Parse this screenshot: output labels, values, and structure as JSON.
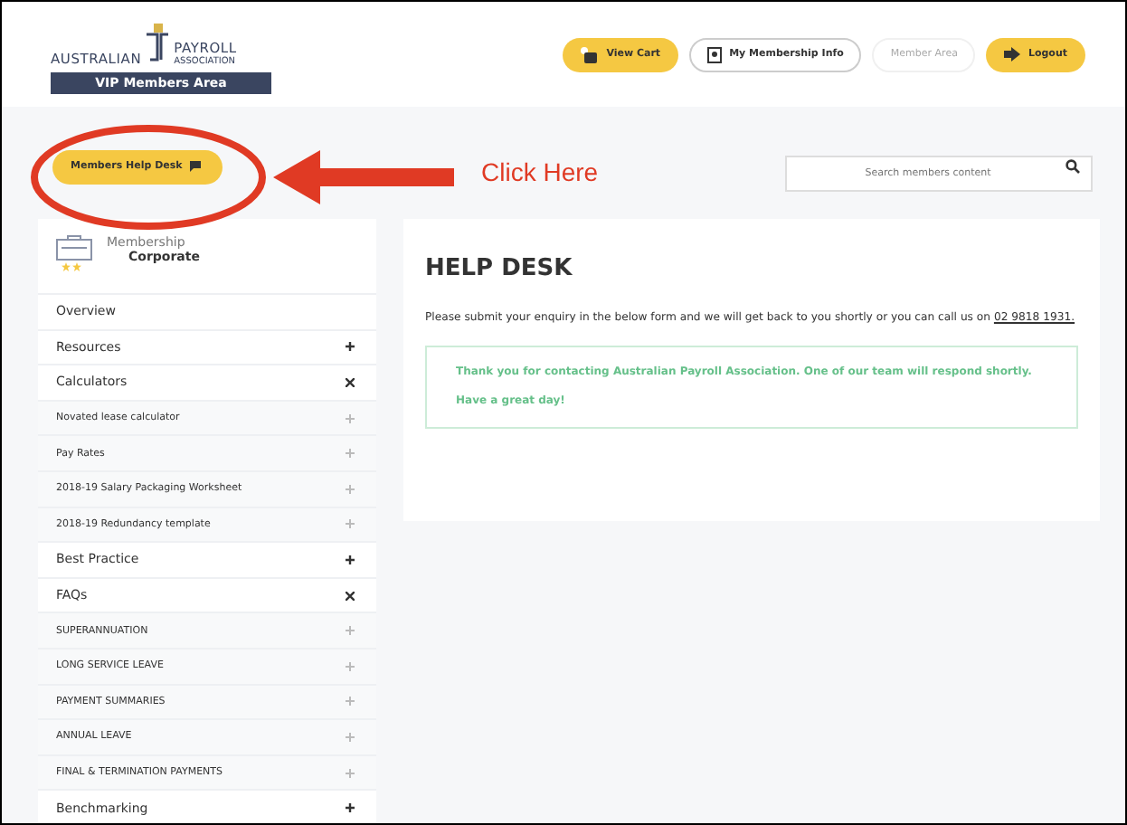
{
  "header": {
    "logo_left": "AUSTRALIAN",
    "logo_right": "PAYROLL",
    "logo_sub": "ASSOCIATION",
    "area_label": "VIP Members Area",
    "buttons": [
      {
        "label": "View Cart",
        "kind": "cart"
      },
      {
        "label": "My Membership Info",
        "kind": "info"
      },
      {
        "label": "Member Area",
        "kind": "plain"
      },
      {
        "label": "Logout",
        "kind": "logout"
      }
    ]
  },
  "toolbar": {
    "help_button": "Members Help Desk",
    "search": {
      "placeholder": "Search members content"
    }
  },
  "annotation": {
    "text": "Click Here"
  },
  "sidebar": {
    "membership_label": "Membership",
    "membership_level": "Corporate",
    "items": [
      {
        "label": "Overview",
        "kind": "section"
      },
      {
        "label": "Resources",
        "kind": "section",
        "expanded": false
      },
      {
        "label": "Calculators",
        "kind": "section",
        "expanded": true
      },
      {
        "label": "Novated lease calculator",
        "kind": "sub"
      },
      {
        "label": "Pay Rates",
        "kind": "sub"
      },
      {
        "label": "2018-19 Salary Packaging Worksheet",
        "kind": "sub"
      },
      {
        "label": "2018-19 Redundancy template",
        "kind": "sub"
      },
      {
        "label": "Best Practice",
        "kind": "section",
        "expanded": false
      },
      {
        "label": "FAQs",
        "kind": "section",
        "expanded": true
      },
      {
        "label": "SUPERANNUATION",
        "kind": "sub"
      },
      {
        "label": "LONG SERVICE LEAVE",
        "kind": "sub"
      },
      {
        "label": "PAYMENT SUMMARIES",
        "kind": "sub"
      },
      {
        "label": "ANNUAL LEAVE",
        "kind": "sub"
      },
      {
        "label": "FINAL & TERMINATION PAYMENTS",
        "kind": "sub"
      },
      {
        "label": "Benchmarking",
        "kind": "section",
        "expanded": false
      }
    ]
  },
  "main": {
    "title": "HELP DESK",
    "intro": "Please submit your enquiry in the below form and we will get back to you shortly or you can call us on",
    "phone": "02 9818 1931.",
    "success": "Thank you for contacting Australian Payroll Association. One of our team will respond shortly. Have a great day!"
  }
}
